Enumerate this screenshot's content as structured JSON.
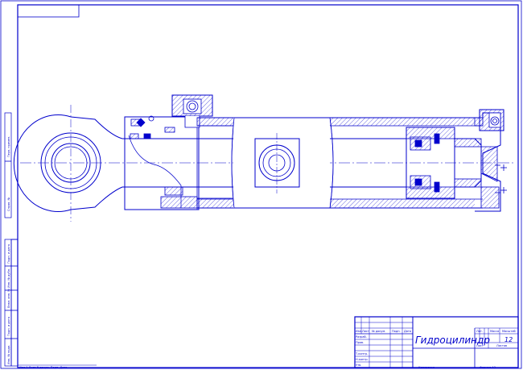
{
  "title_block": {
    "title": "Гидроцилиндр",
    "sheet_number": "12",
    "stamp_row_labels": [
      "Изм.",
      "Лист",
      "№ докум.",
      "Подп.",
      "Дата"
    ],
    "role_labels": [
      "Разраб.",
      "Пров.",
      "Т.контр.",
      "Н.контр.",
      "Утв."
    ],
    "letter_header": "Лит.",
    "mass_header": "Масса",
    "scale_header": "Масштаб",
    "sheet_label": "Лист",
    "sheets_label": "Листов",
    "copied_label": "Копировал",
    "format_label": "Формат  А3"
  },
  "side_column": {
    "labels": [
      "Перв. примен.",
      "Справ. №",
      "Подп. и дата",
      "Инв. № дубл.",
      "Взам. инв. №",
      "Подп. и дата",
      "Инв. № подл."
    ]
  },
  "footer": {
    "left_note": "Изм.1  Лист  №докум.  Подп.  Дата"
  },
  "colors": {
    "line": "#0000cc",
    "background": "#ffffff"
  }
}
